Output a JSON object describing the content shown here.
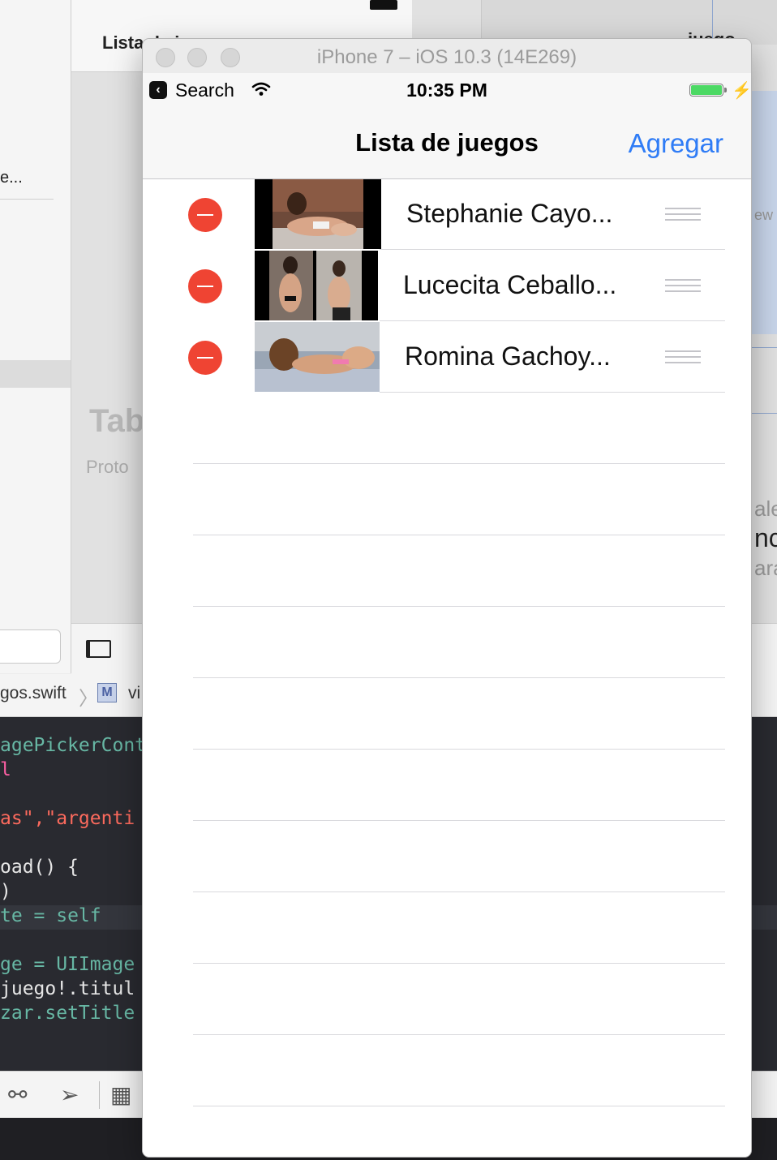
{
  "xcode": {
    "left_truncated_item": "e...",
    "scene_title": "Lista de juegos",
    "scene2_title": "juego",
    "placeholder_tab": "Tab",
    "placeholder_proto": "Proto",
    "peek_labels": [
      "ew",
      "ale",
      "nc",
      "ara"
    ],
    "jump_bar": {
      "file": "gos.swift",
      "module_letter": "M",
      "symbol": "vi"
    },
    "code_lines": [
      "agePickerCont",
      "l",
      "as\",\"argenti",
      "oad() {",
      ")",
      "te = self",
      "ge = UIImage",
      "juego!.titul",
      "zar.setTitle"
    ]
  },
  "simulator": {
    "window_title": "iPhone 7 – iOS 10.3 (14E269)",
    "status_bar": {
      "back_app": "Search",
      "time": "10:35 PM",
      "battery_level": 1.0,
      "charging": true
    },
    "navbar": {
      "title": "Lista de juegos",
      "right_button": "Agregar",
      "accent_color": "#2f7cf6"
    },
    "table": {
      "editing": true,
      "rows": [
        {
          "label": "Stephanie Cayo...",
          "thumbnail": "photo-stephanie"
        },
        {
          "label": "Lucecita Ceballo...",
          "thumbnail": "photo-collage-lucecita"
        },
        {
          "label": "Romina Gachoy...",
          "thumbnail": "photo-romina"
        }
      ],
      "delete_color": "#ef4433"
    }
  }
}
